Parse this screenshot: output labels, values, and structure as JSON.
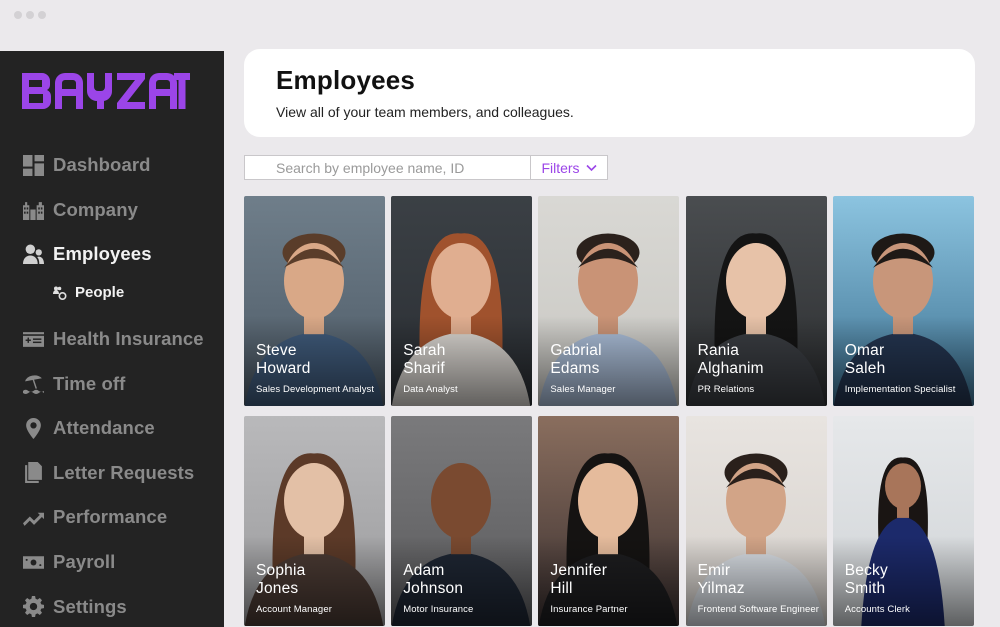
{
  "brand": {
    "name": "BAYZAT",
    "accent": "#9b45e8"
  },
  "sidebar": {
    "items": [
      {
        "label": "Dashboard",
        "icon": "dashboard-icon",
        "active": false
      },
      {
        "label": "Company",
        "icon": "buildings-icon",
        "active": false
      },
      {
        "label": "Employees",
        "icon": "users-icon",
        "active": true
      },
      {
        "label": "Health Insurance",
        "icon": "insurance-card-icon",
        "active": false
      },
      {
        "label": "Time off",
        "icon": "beach-umbrella-icon",
        "active": false
      },
      {
        "label": "Attendance",
        "icon": "location-pin-icon",
        "active": false
      },
      {
        "label": "Letter Requests",
        "icon": "documents-icon",
        "active": false
      },
      {
        "label": "Performance",
        "icon": "trending-up-icon",
        "active": false
      },
      {
        "label": "Payroll",
        "icon": "money-icon",
        "active": false
      },
      {
        "label": "Settings",
        "icon": "gear-icon",
        "active": false
      }
    ],
    "sub_item": {
      "label": "People",
      "icon": "people-settings-icon"
    }
  },
  "header": {
    "title": "Employees",
    "subtitle": "View all of your team members, and colleagues."
  },
  "search": {
    "placeholder": "Search by employee name, ID",
    "value": "",
    "filters_label": "Filters"
  },
  "employees": [
    {
      "first": "Steve",
      "last": "Howard",
      "role": "Sales Development Analyst"
    },
    {
      "first": "Sarah",
      "last": "Sharif",
      "role": "Data Analyst"
    },
    {
      "first": "Gabrial",
      "last": "Edams",
      "role": "Sales Manager"
    },
    {
      "first": "Rania",
      "last": "Alghanim",
      "role": "PR Relations"
    },
    {
      "first": "Omar",
      "last": "Saleh",
      "role": "Implementation Specialist"
    },
    {
      "first": "Sophia",
      "last": "Jones",
      "role": "Account Manager"
    },
    {
      "first": "Adam",
      "last": "Johnson",
      "role": "Motor Insurance"
    },
    {
      "first": "Jennifer",
      "last": "Hill",
      "role": "Insurance Partner"
    },
    {
      "first": "Emir",
      "last": "Yilmaz",
      "role": "Frontend Software Engineer"
    },
    {
      "first": "Becky",
      "last": "Smith",
      "role": "Accounts Clerk"
    }
  ]
}
